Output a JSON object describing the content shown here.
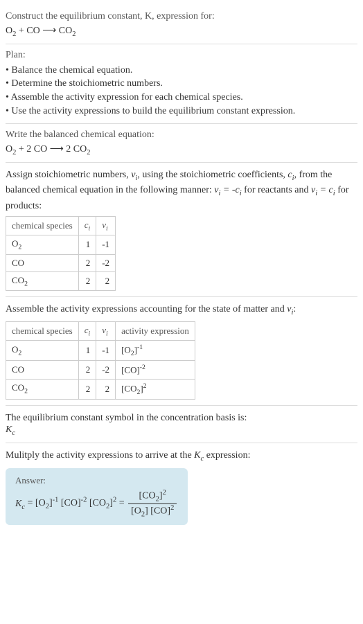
{
  "intro": {
    "title": "Construct the equilibrium constant, K, expression for:",
    "equation": "O₂ + CO ⟶ CO₂"
  },
  "plan": {
    "title": "Plan:",
    "items": [
      "Balance the chemical equation.",
      "Determine the stoichiometric numbers.",
      "Assemble the activity expression for each chemical species.",
      "Use the activity expressions to build the equilibrium constant expression."
    ]
  },
  "balanced": {
    "title": "Write the balanced chemical equation:",
    "equation": "O₂ + 2 CO ⟶ 2 CO₂"
  },
  "stoich": {
    "desc_pre": "Assign stoichiometric numbers, ",
    "desc_mid1": ", using the stoichiometric coefficients, ",
    "desc_mid2": ", from the balanced chemical equation in the following manner: ",
    "desc_mid3": " for reactants and ",
    "desc_end": " for products:",
    "headers": [
      "chemical species",
      "cᵢ",
      "νᵢ"
    ],
    "rows": [
      {
        "species": "O₂",
        "c": "1",
        "v": "-1"
      },
      {
        "species": "CO",
        "c": "2",
        "v": "-2"
      },
      {
        "species": "CO₂",
        "c": "2",
        "v": "2"
      }
    ]
  },
  "activity": {
    "desc_pre": "Assemble the activity expressions accounting for the state of matter and ",
    "desc_end": ":",
    "headers": [
      "chemical species",
      "cᵢ",
      "νᵢ",
      "activity expression"
    ],
    "rows": [
      {
        "species": "O₂",
        "c": "1",
        "v": "-1",
        "expr": "[O₂]⁻¹"
      },
      {
        "species": "CO",
        "c": "2",
        "v": "-2",
        "expr": "[CO]⁻²"
      },
      {
        "species": "CO₂",
        "c": "2",
        "v": "2",
        "expr": "[CO₂]²"
      }
    ]
  },
  "symbol": {
    "desc": "The equilibrium constant symbol in the concentration basis is:",
    "sym": "K_c"
  },
  "multiply": {
    "desc_pre": "Mulitply the activity expressions to arrive at the ",
    "desc_end": " expression:"
  },
  "answer": {
    "label": "Answer:",
    "kc_lhs": "K_c = [O₂]⁻¹ [CO]⁻² [CO₂]² = ",
    "frac_num": "[CO₂]²",
    "frac_den": "[O₂] [CO]²"
  }
}
